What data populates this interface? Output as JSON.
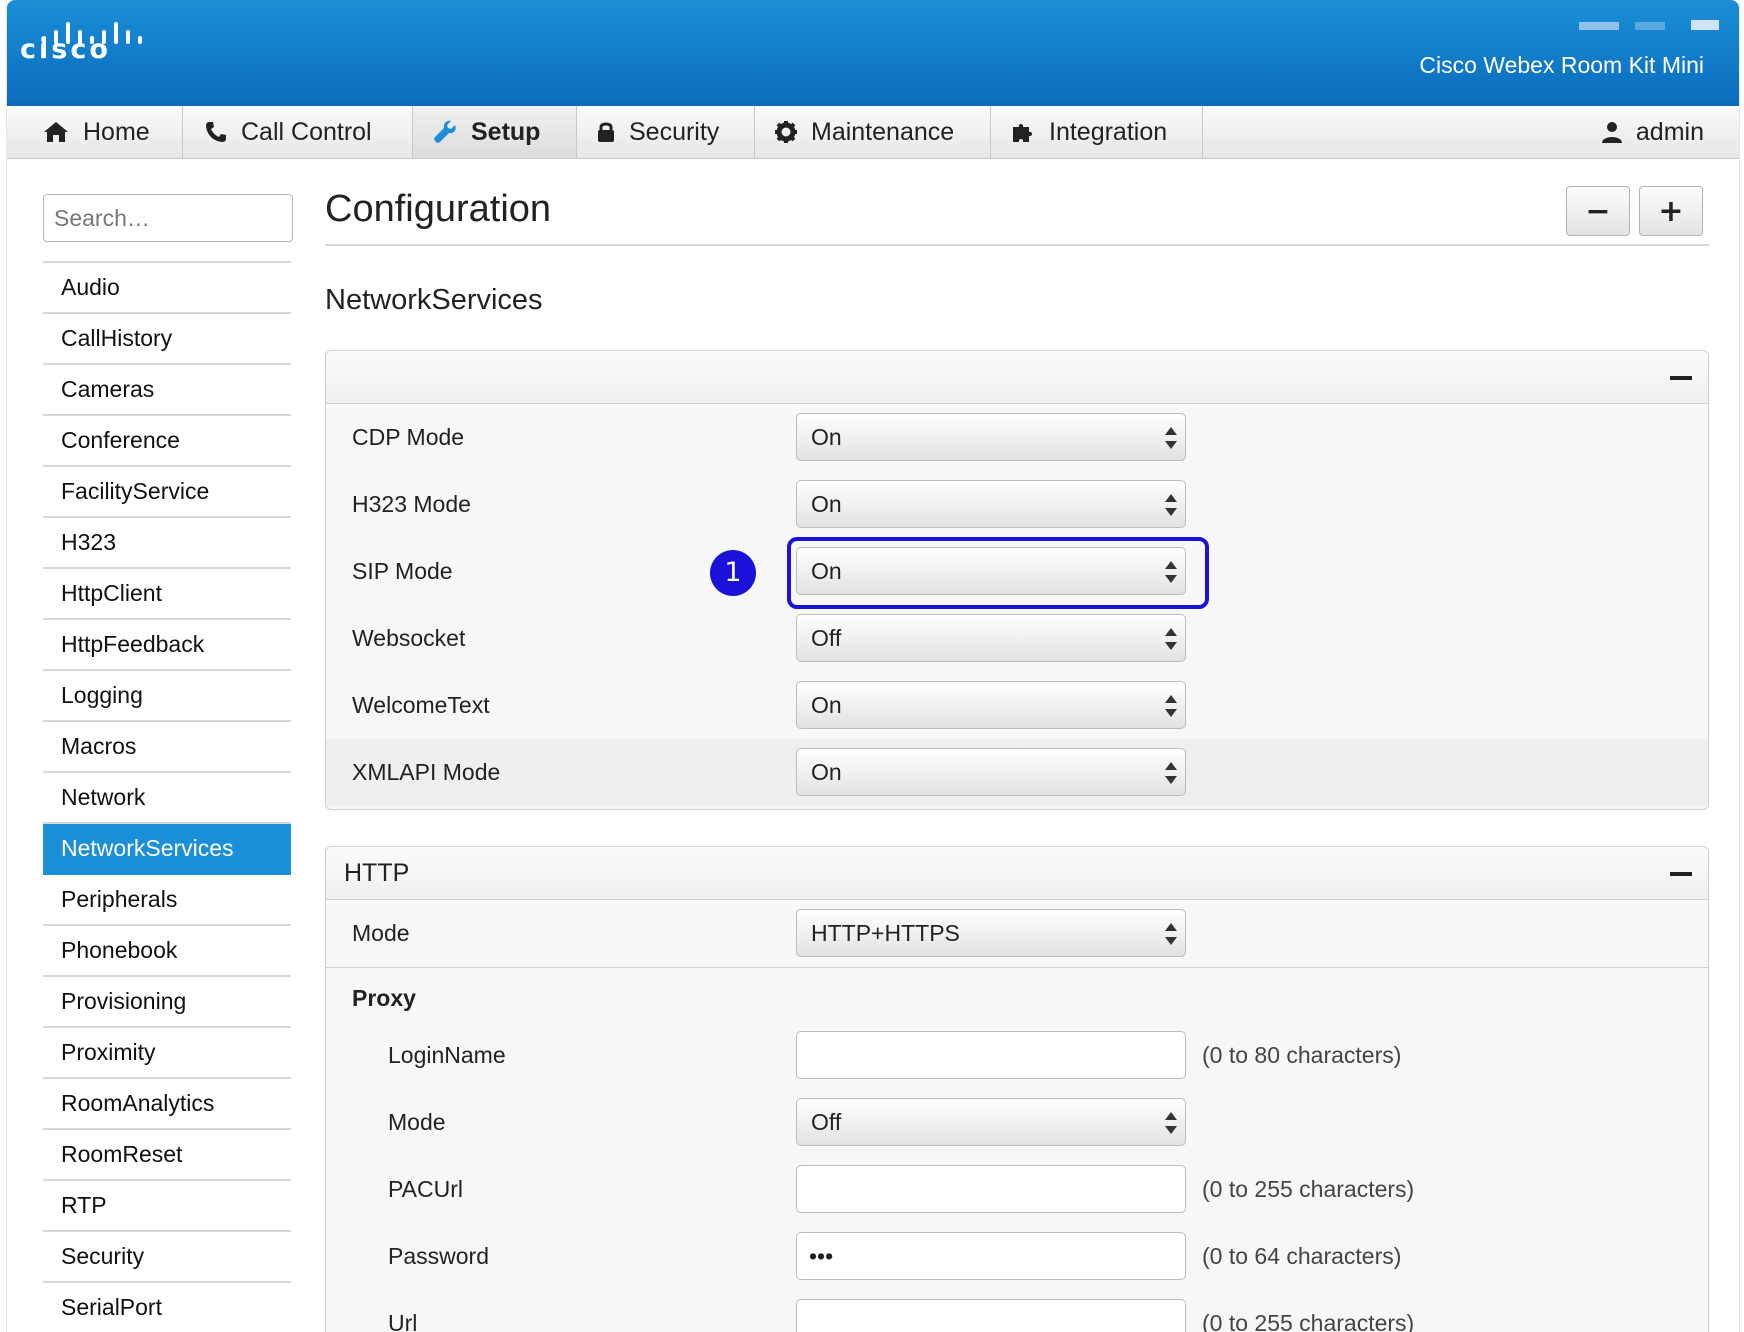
{
  "header": {
    "logo_text": "cisco",
    "product_name": "Cisco Webex Room Kit Mini"
  },
  "nav": {
    "tabs": [
      {
        "label": "Home",
        "icon": "home-icon"
      },
      {
        "label": "Call Control",
        "icon": "phone-icon"
      },
      {
        "label": "Setup",
        "icon": "wrench-icon",
        "active": true
      },
      {
        "label": "Security",
        "icon": "lock-icon"
      },
      {
        "label": "Maintenance",
        "icon": "gear-icon"
      },
      {
        "label": "Integration",
        "icon": "puzzle-icon"
      }
    ],
    "user": "admin"
  },
  "sidebar": {
    "search_placeholder": "Search…",
    "items": [
      "Audio",
      "CallHistory",
      "Cameras",
      "Conference",
      "FacilityService",
      "H323",
      "HttpClient",
      "HttpFeedback",
      "Logging",
      "Macros",
      "Network",
      "NetworkServices",
      "Peripherals",
      "Phonebook",
      "Provisioning",
      "Proximity",
      "RoomAnalytics",
      "RoomReset",
      "RTP",
      "Security",
      "SerialPort"
    ],
    "active_item": "NetworkServices"
  },
  "main": {
    "title": "Configuration",
    "collapse_all": "−",
    "expand_all": "+",
    "section_title": "NetworkServices",
    "general_panel": {
      "title": "",
      "rows": [
        {
          "label": "CDP Mode",
          "value": "On"
        },
        {
          "label": "H323 Mode",
          "value": "On"
        },
        {
          "label": "SIP Mode",
          "value": "On"
        },
        {
          "label": "Websocket",
          "value": "Off"
        },
        {
          "label": "WelcomeText",
          "value": "On"
        },
        {
          "label": "XMLAPI Mode",
          "value": "On"
        }
      ]
    },
    "annotation": {
      "number": "1",
      "color": "#1a12d8"
    },
    "http_panel": {
      "title": "HTTP",
      "mode_label": "Mode",
      "mode_value": "HTTP+HTTPS",
      "proxy_label": "Proxy",
      "proxy_rows": [
        {
          "label": "LoginName",
          "type": "text",
          "value": "",
          "hint": "(0 to 80 characters)"
        },
        {
          "label": "Mode",
          "type": "select",
          "value": "Off",
          "hint": ""
        },
        {
          "label": "PACUrl",
          "type": "text",
          "value": "",
          "hint": "(0 to 255 characters)"
        },
        {
          "label": "Password",
          "type": "text",
          "value": "•••",
          "hint": "(0 to 64 characters)"
        },
        {
          "label": "Url",
          "type": "text",
          "value": "",
          "hint": "(0 to 255 characters)"
        }
      ]
    }
  },
  "colors": {
    "header_blue": "#0a6bbd",
    "sidebar_active": "#1c8fd9",
    "annotation": "#1a12d8"
  }
}
